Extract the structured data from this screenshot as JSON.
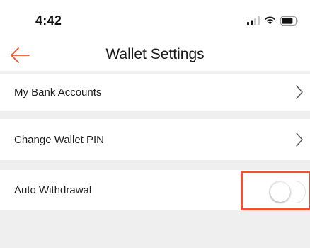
{
  "status_bar": {
    "time": "4:42",
    "icons": [
      "signal-icon",
      "wifi-icon",
      "battery-icon"
    ]
  },
  "header": {
    "title": "Wallet Settings",
    "back_icon": "back-arrow-icon",
    "accent_color": "#f0522f"
  },
  "settings": {
    "items": [
      {
        "label": "My Bank Accounts",
        "icon": "chevron-right-icon"
      },
      {
        "label": "Change Wallet PIN",
        "icon": "chevron-right-icon"
      },
      {
        "label": "Auto Withdrawal",
        "toggle_on": false
      }
    ]
  },
  "colors": {
    "highlight": "#f0522f",
    "background": "#efefef"
  }
}
